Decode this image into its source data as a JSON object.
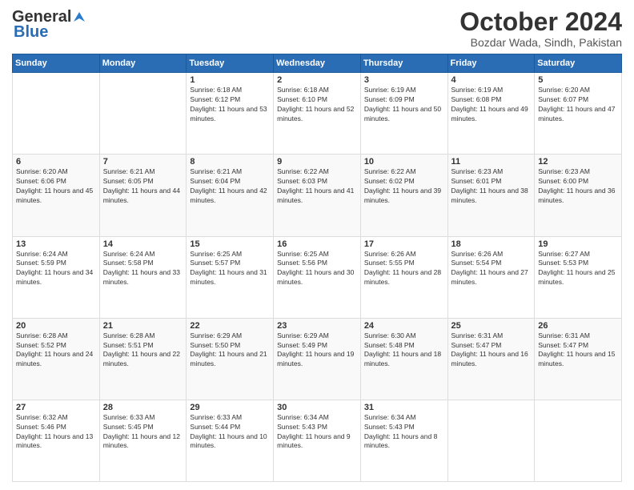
{
  "header": {
    "logo_general": "General",
    "logo_blue": "Blue",
    "title": "October 2024",
    "location": "Bozdar Wada, Sindh, Pakistan"
  },
  "days_of_week": [
    "Sunday",
    "Monday",
    "Tuesday",
    "Wednesday",
    "Thursday",
    "Friday",
    "Saturday"
  ],
  "weeks": [
    [
      {
        "day": "",
        "info": ""
      },
      {
        "day": "",
        "info": ""
      },
      {
        "day": "1",
        "info": "Sunrise: 6:18 AM\nSunset: 6:12 PM\nDaylight: 11 hours and 53 minutes."
      },
      {
        "day": "2",
        "info": "Sunrise: 6:18 AM\nSunset: 6:10 PM\nDaylight: 11 hours and 52 minutes."
      },
      {
        "day": "3",
        "info": "Sunrise: 6:19 AM\nSunset: 6:09 PM\nDaylight: 11 hours and 50 minutes."
      },
      {
        "day": "4",
        "info": "Sunrise: 6:19 AM\nSunset: 6:08 PM\nDaylight: 11 hours and 49 minutes."
      },
      {
        "day": "5",
        "info": "Sunrise: 6:20 AM\nSunset: 6:07 PM\nDaylight: 11 hours and 47 minutes."
      }
    ],
    [
      {
        "day": "6",
        "info": "Sunrise: 6:20 AM\nSunset: 6:06 PM\nDaylight: 11 hours and 45 minutes."
      },
      {
        "day": "7",
        "info": "Sunrise: 6:21 AM\nSunset: 6:05 PM\nDaylight: 11 hours and 44 minutes."
      },
      {
        "day": "8",
        "info": "Sunrise: 6:21 AM\nSunset: 6:04 PM\nDaylight: 11 hours and 42 minutes."
      },
      {
        "day": "9",
        "info": "Sunrise: 6:22 AM\nSunset: 6:03 PM\nDaylight: 11 hours and 41 minutes."
      },
      {
        "day": "10",
        "info": "Sunrise: 6:22 AM\nSunset: 6:02 PM\nDaylight: 11 hours and 39 minutes."
      },
      {
        "day": "11",
        "info": "Sunrise: 6:23 AM\nSunset: 6:01 PM\nDaylight: 11 hours and 38 minutes."
      },
      {
        "day": "12",
        "info": "Sunrise: 6:23 AM\nSunset: 6:00 PM\nDaylight: 11 hours and 36 minutes."
      }
    ],
    [
      {
        "day": "13",
        "info": "Sunrise: 6:24 AM\nSunset: 5:59 PM\nDaylight: 11 hours and 34 minutes."
      },
      {
        "day": "14",
        "info": "Sunrise: 6:24 AM\nSunset: 5:58 PM\nDaylight: 11 hours and 33 minutes."
      },
      {
        "day": "15",
        "info": "Sunrise: 6:25 AM\nSunset: 5:57 PM\nDaylight: 11 hours and 31 minutes."
      },
      {
        "day": "16",
        "info": "Sunrise: 6:25 AM\nSunset: 5:56 PM\nDaylight: 11 hours and 30 minutes."
      },
      {
        "day": "17",
        "info": "Sunrise: 6:26 AM\nSunset: 5:55 PM\nDaylight: 11 hours and 28 minutes."
      },
      {
        "day": "18",
        "info": "Sunrise: 6:26 AM\nSunset: 5:54 PM\nDaylight: 11 hours and 27 minutes."
      },
      {
        "day": "19",
        "info": "Sunrise: 6:27 AM\nSunset: 5:53 PM\nDaylight: 11 hours and 25 minutes."
      }
    ],
    [
      {
        "day": "20",
        "info": "Sunrise: 6:28 AM\nSunset: 5:52 PM\nDaylight: 11 hours and 24 minutes."
      },
      {
        "day": "21",
        "info": "Sunrise: 6:28 AM\nSunset: 5:51 PM\nDaylight: 11 hours and 22 minutes."
      },
      {
        "day": "22",
        "info": "Sunrise: 6:29 AM\nSunset: 5:50 PM\nDaylight: 11 hours and 21 minutes."
      },
      {
        "day": "23",
        "info": "Sunrise: 6:29 AM\nSunset: 5:49 PM\nDaylight: 11 hours and 19 minutes."
      },
      {
        "day": "24",
        "info": "Sunrise: 6:30 AM\nSunset: 5:48 PM\nDaylight: 11 hours and 18 minutes."
      },
      {
        "day": "25",
        "info": "Sunrise: 6:31 AM\nSunset: 5:47 PM\nDaylight: 11 hours and 16 minutes."
      },
      {
        "day": "26",
        "info": "Sunrise: 6:31 AM\nSunset: 5:47 PM\nDaylight: 11 hours and 15 minutes."
      }
    ],
    [
      {
        "day": "27",
        "info": "Sunrise: 6:32 AM\nSunset: 5:46 PM\nDaylight: 11 hours and 13 minutes."
      },
      {
        "day": "28",
        "info": "Sunrise: 6:33 AM\nSunset: 5:45 PM\nDaylight: 11 hours and 12 minutes."
      },
      {
        "day": "29",
        "info": "Sunrise: 6:33 AM\nSunset: 5:44 PM\nDaylight: 11 hours and 10 minutes."
      },
      {
        "day": "30",
        "info": "Sunrise: 6:34 AM\nSunset: 5:43 PM\nDaylight: 11 hours and 9 minutes."
      },
      {
        "day": "31",
        "info": "Sunrise: 6:34 AM\nSunset: 5:43 PM\nDaylight: 11 hours and 8 minutes."
      },
      {
        "day": "",
        "info": ""
      },
      {
        "day": "",
        "info": ""
      }
    ]
  ]
}
